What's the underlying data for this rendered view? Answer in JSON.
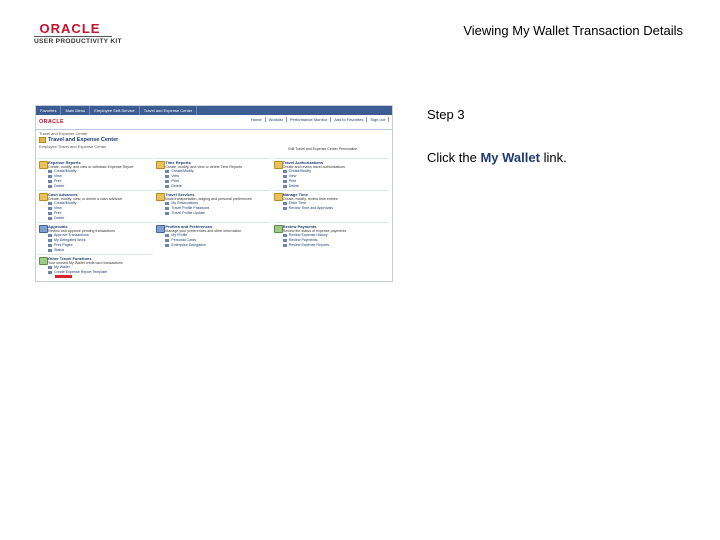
{
  "brand": {
    "name": "ORACLE",
    "subtitle": "USER PRODUCTIVITY KIT"
  },
  "document": {
    "title": "Viewing My Wallet Transaction Details",
    "step": "Step 3",
    "instruction_prefix": "Click the ",
    "instruction_link": "My Wallet",
    "instruction_suffix": " link."
  },
  "screenshot": {
    "menubar": [
      "Favorites",
      "Main Menu",
      "Employee Self-Service",
      "Travel and Expense Center"
    ],
    "brand": "ORACLE",
    "nav": [
      "Home",
      "Worklist",
      "Performance Monitor",
      "Add to Favorites",
      "Sign out"
    ],
    "breadcrumb": "Travel and Expense Center",
    "title": "Travel and Expense Center",
    "personalize": "Edit Travel and Expense Center  Personalize",
    "subtitle": "Employee Travel and Expense Center",
    "sections": [
      {
        "title": "Expense Reports",
        "desc": "Create, modify, and view or withdraw Expense Report",
        "links": [
          "Create/Modify",
          "View",
          "Print",
          "Delete"
        ],
        "color": "yellow"
      },
      {
        "title": "Time Reports",
        "desc": "Create, modify, and view or delete Time Reports",
        "links": [
          "Create/Modify",
          "View",
          "Print",
          "Delete"
        ],
        "color": "yellow"
      },
      {
        "title": "Travel Authorizations",
        "desc": "Create and review travel authorizations",
        "links": [
          "Create/Modify",
          "View",
          "Print",
          "Delete"
        ],
        "color": "yellow"
      },
      {
        "title": "Cash Advances",
        "desc": "Create, modify, view, or delete a cash advance",
        "links": [
          "Create/Modify",
          "View",
          "Print",
          "Delete"
        ],
        "color": "yellow"
      },
      {
        "title": "Travel Services",
        "desc": "Book transportation, lodging and personal preferences",
        "links": [
          "My Reservations",
          "Travel Profile Password",
          "Travel Profile Update"
        ],
        "color": "yellow"
      },
      {
        "title": "Manage Time",
        "desc": "Create, modify, review time entries",
        "links": [
          "Enter Time",
          "Review Time and Approvals"
        ],
        "color": "yellow"
      },
      {
        "title": "Approvals",
        "desc": "Review and approve pending transactions",
        "links": [
          "Approve Transactions",
          "My Delegated Work",
          "Print Pages",
          "Status"
        ],
        "color": "blue"
      },
      {
        "title": "Profiles and Preferences",
        "desc": "Manage your preferences and other information",
        "links": [
          "My Profile",
          "Personal Cards",
          "Enterprise Delegation"
        ],
        "color": "blue"
      },
      {
        "title": "Review Payments",
        "desc": "Review the status of expense payments",
        "links": [
          "Review Expense History",
          "Review Payments",
          "Review Expense Reports"
        ],
        "color": "green"
      },
      {
        "title": "Other Travel Functions",
        "desc": "Your unused My Wallet credit card transactions",
        "links": [
          "My Wallet",
          "Create Expense Report Template"
        ],
        "color": "green"
      }
    ]
  }
}
